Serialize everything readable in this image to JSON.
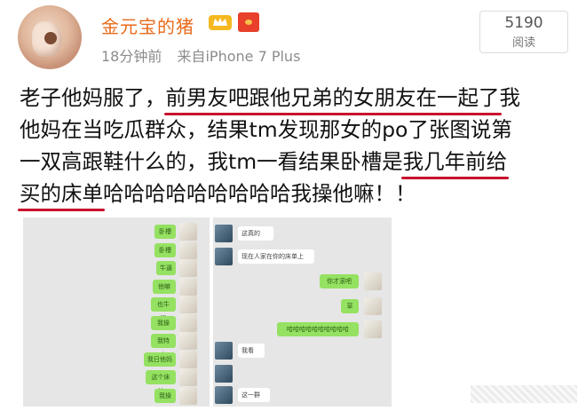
{
  "header": {
    "username": "金元宝的猪",
    "time": "18分钟前",
    "source": "来自iPhone 7 Plus",
    "reads_count": "5190",
    "reads_label": "阅读"
  },
  "post": {
    "lines": [
      [
        {
          "t": "老子他妈服了，"
        },
        {
          "t": "前男友吧跟他兄弟的女朋友在一起了",
          "u": true
        },
        {
          "t": "我"
        }
      ],
      [
        {
          "t": "他妈在当吃瓜群众，结果tm发现那女的po了张图说第"
        }
      ],
      [
        {
          "t": "一双高跟鞋什么的，我tm一看结果卧槽是"
        },
        {
          "t": "我几年前给",
          "u": true
        }
      ],
      [
        {
          "t": "买的床单",
          "u": true
        },
        {
          "t": "哈哈哈哈哈哈哈哈哈我操他嘛！！"
        }
      ]
    ]
  },
  "screenshot": {
    "left_bubbles": [
      "卧槽",
      "卧槽",
      "牛逼",
      "他嘛",
      "也牛逼",
      "我操了",
      "我特么",
      "我日他妈",
      "这个床单",
      "我操"
    ],
    "right_bubbles_white": [
      "这真的",
      "现在人家在你的床单上",
      "我看",
      "这一群"
    ],
    "right_bubbles_green": [
      "你才滚吧",
      "哈哈哈哈哈哈哈哈哈哈"
    ],
    "right_small": [
      "草"
    ]
  },
  "colors": {
    "username": "#e86a1a",
    "underline": "#c8102e",
    "wechat_green": "#95e162"
  }
}
